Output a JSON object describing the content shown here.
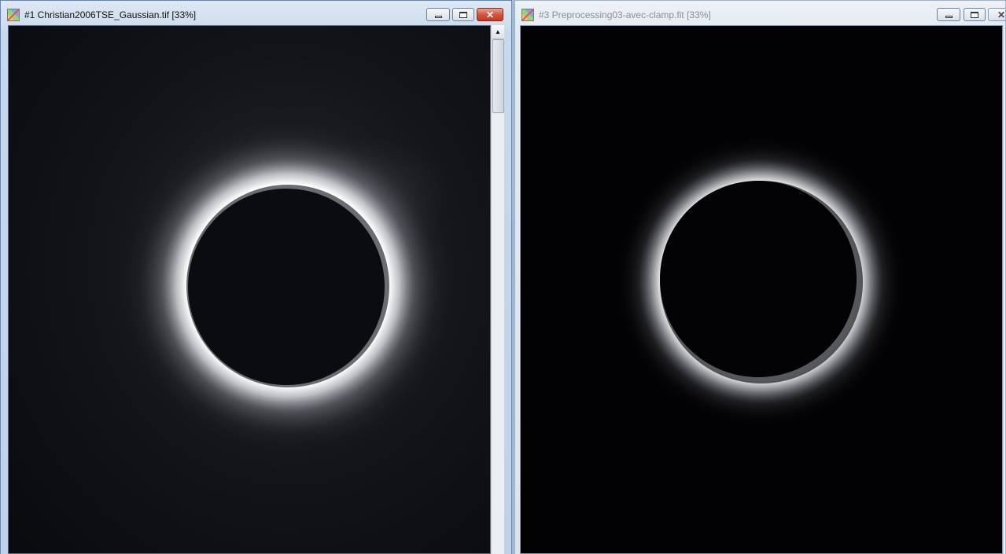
{
  "windows": [
    {
      "title": "#1 Christian2006TSE_Gaussian.tif  [33%]",
      "state": "active",
      "close_glyph": "✕",
      "image": "solar eclipse corona, Gaussian processed"
    },
    {
      "title": "#3 Preprocessing03-avec-clamp.fit  [33%]",
      "state": "inactive",
      "image": "solar eclipse corona, preprocessed with clamp"
    }
  ],
  "scrollbar": {
    "up_arrow": "▲"
  },
  "colors": {
    "desktop": "#9db9d6",
    "close_button": "#c8432b",
    "image_background": "#000000"
  },
  "icons": [
    "app-icon",
    "minimize-icon",
    "maximize-icon",
    "close-icon",
    "scroll-up-arrow-icon"
  ]
}
